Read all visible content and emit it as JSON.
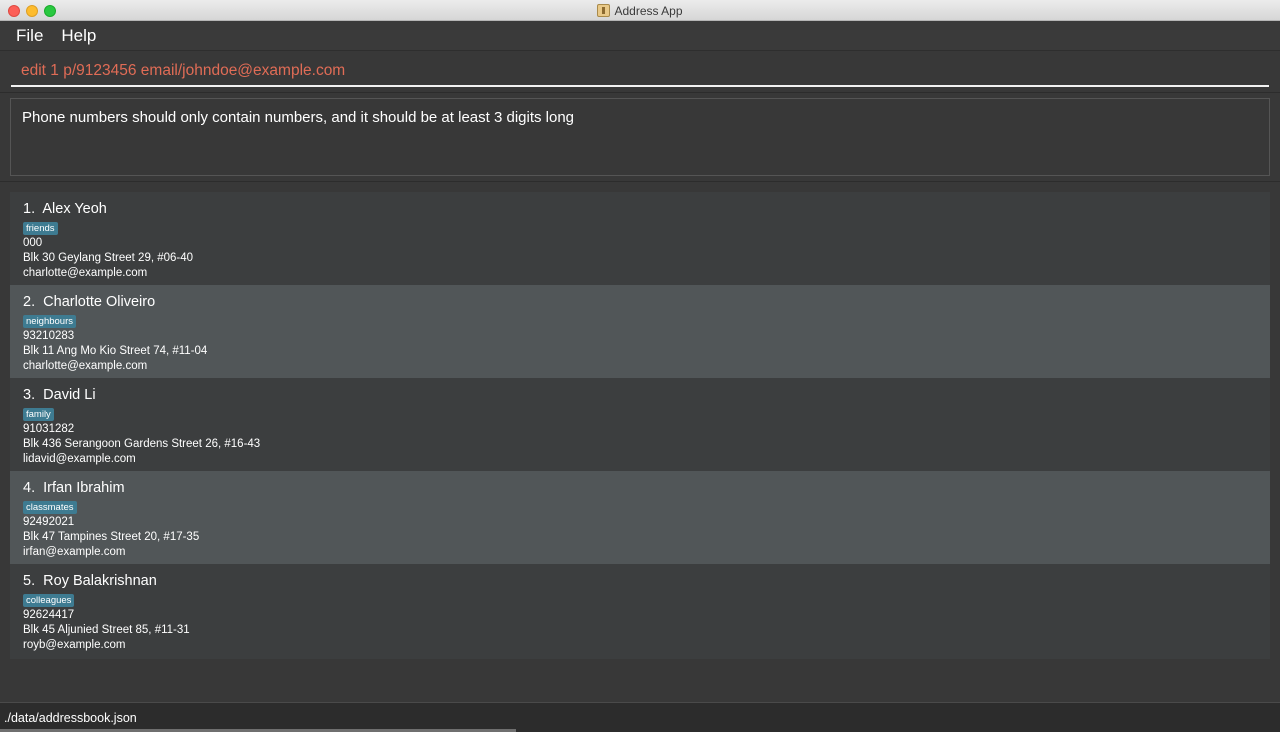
{
  "window": {
    "title": "Address App"
  },
  "menu": {
    "items": [
      "File",
      "Help"
    ]
  },
  "command": {
    "value": "edit 1 p/9123456 email/johndoe@example.com"
  },
  "result": {
    "message": "Phone numbers should only contain numbers, and it should be at least 3 digits long"
  },
  "persons": [
    {
      "index": "1.",
      "name": "Alex Yeoh",
      "tag": "friends",
      "phone": "000",
      "address": "Blk 30 Geylang Street 29, #06-40",
      "email": "charlotte@example.com"
    },
    {
      "index": "2.",
      "name": "Charlotte Oliveiro",
      "tag": "neighbours",
      "phone": "93210283",
      "address": "Blk 11 Ang Mo Kio Street 74, #11-04",
      "email": "charlotte@example.com"
    },
    {
      "index": "3.",
      "name": "David Li",
      "tag": "family",
      "phone": "91031282",
      "address": "Blk 436 Serangoon Gardens Street 26, #16-43",
      "email": "lidavid@example.com"
    },
    {
      "index": "4.",
      "name": "Irfan Ibrahim",
      "tag": "classmates",
      "phone": "92492021",
      "address": "Blk 47 Tampines Street 20, #17-35",
      "email": "irfan@example.com"
    },
    {
      "index": "5.",
      "name": "Roy Balakrishnan",
      "tag": "colleagues",
      "phone": "92624417",
      "address": "Blk 45 Aljunied Street 85, #11-31",
      "email": "royb@example.com"
    }
  ],
  "status": {
    "path": "./data/addressbook.json"
  },
  "colors": {
    "background": "#383838",
    "command_text": "#e06c56",
    "tag_bg": "#3e7b91",
    "card_alt_bg": "#515658"
  }
}
